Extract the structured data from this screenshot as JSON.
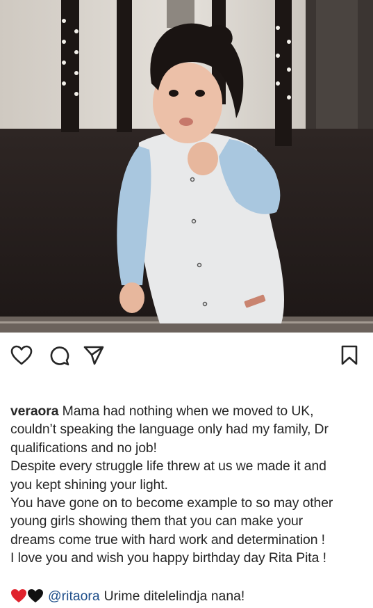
{
  "post": {
    "photo": {
      "icon": "photo-of-toddler-in-light-blue-romper",
      "colors": {
        "background_dark": "#2b2523",
        "wall": "#d9d4cd",
        "romper": "#e8e9ea",
        "sleeve": "#a9c7df",
        "hair": "#1a1412"
      }
    },
    "actions": {
      "like_icon": "heart-outline-icon",
      "comment_icon": "comment-bubble-icon",
      "share_icon": "paper-plane-icon",
      "save_icon": "bookmark-icon"
    },
    "caption": {
      "username": "veraora",
      "lines": [
        " Mama had nothing when we moved to UK,",
        "couldn’t speaking the language only had my family, Dr",
        "qualifications and no job!",
        "Despite every struggle life threw at us we made it and",
        "you kept shining your light.",
        "You have gone on to become example to so may other",
        "young girls showing them that you can make your",
        "dreams come true with hard work and determination !",
        "I love you and wish you happy birthday day Rita Pita !"
      ]
    },
    "comment": {
      "emoji": [
        "red-heart",
        "black-heart"
      ],
      "mention": "@ritaora",
      "text": "Urime ditelelindja nana!"
    }
  }
}
